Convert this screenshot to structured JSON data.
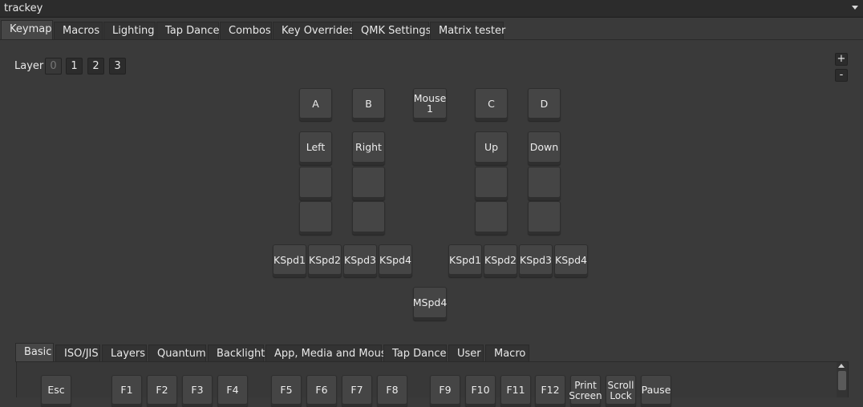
{
  "device": {
    "selected": "trackey"
  },
  "main_tabs": [
    "Keymap",
    "Macros",
    "Lighting",
    "Tap Dance",
    "Combos",
    "Key Overrides",
    "QMK Settings",
    "Matrix tester"
  ],
  "layer": {
    "label": "Layer",
    "options": [
      "0",
      "1",
      "2",
      "3"
    ],
    "selected": "0"
  },
  "zoom": {
    "plus": "+",
    "minus": "-"
  },
  "keys": {
    "a": "A",
    "b": "B",
    "mouse1": "Mouse\n1",
    "c": "C",
    "d": "D",
    "left": "Left",
    "right": "Right",
    "up": "Up",
    "down": "Down",
    "empty": "",
    "kspd1": "KSpd1",
    "kspd2": "KSpd2",
    "kspd3": "KSpd3",
    "kspd4": "KSpd4",
    "mspd4": "MSpd4"
  },
  "bottom_tabs": [
    "Basic",
    "ISO/JIS",
    "Layers",
    "Quantum",
    "Backlight",
    "App, Media and Mouse",
    "Tap Dance",
    "User",
    "Macro"
  ],
  "basic_keys": [
    "Esc",
    "F1",
    "F2",
    "F3",
    "F4",
    "F5",
    "F6",
    "F7",
    "F8",
    "F9",
    "F10",
    "F11",
    "F12",
    "Print\nScreen",
    "Scroll\nLock",
    "Pause"
  ]
}
